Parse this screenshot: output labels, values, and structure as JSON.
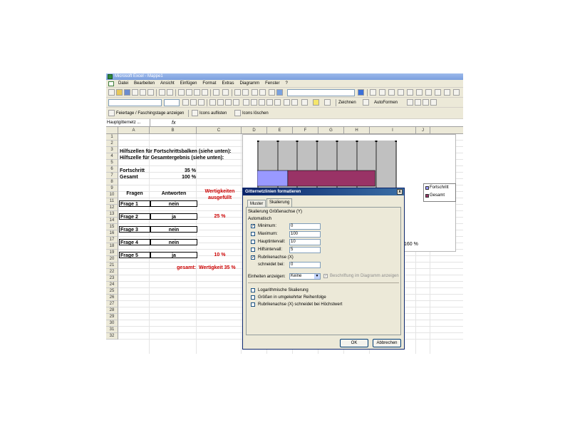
{
  "window": {
    "title": "Microsoft Excel - Mappe1"
  },
  "menubar": [
    "Datei",
    "Bearbeiten",
    "Ansicht",
    "Einfügen",
    "Format",
    "Extras",
    "Diagramm",
    "Fenster",
    "?"
  ],
  "toolbar3": {
    "draw_label": "Zeichnen",
    "autoshapes_label": "AutoFormen"
  },
  "toolbar4": {
    "holidays_button": "Feiertage / Faschingstage anzeigen",
    "list_icons_button": "Icons auflisten",
    "delete_icons_button": "Icons löschen"
  },
  "formula_bar": {
    "name_box": "Hauptgitternetz ...",
    "fx": "fx"
  },
  "columns": [
    "A",
    "B",
    "C",
    "D",
    "E",
    "F",
    "G",
    "H",
    "I",
    "J"
  ],
  "rows": [
    "1",
    "2",
    "3",
    "4",
    "5",
    "6",
    "7",
    "8",
    "9",
    "10",
    "11",
    "12",
    "13",
    "14",
    "15",
    "16",
    "17",
    "18",
    "19",
    "20",
    "21",
    "22",
    "23",
    "24",
    "25",
    "26",
    "27",
    "28",
    "29",
    "30",
    "31",
    "32"
  ],
  "sheet": {
    "a2": "Hilfszellen für Fortschrittsbalken (siehe unten):",
    "a3": "Hilfszelle für Gesamtergebnis (siehe unten):",
    "a5": "Fortschritt",
    "b5": "35 %",
    "a6": "Gesamt",
    "b6": "100 %",
    "a9": "Fragen",
    "b9": "Antworten",
    "c9": "Wertigkeiten ausgefüllt",
    "a10": "Frage 1",
    "b10": "nein",
    "a12": "Frage 2",
    "b12": "ja",
    "c12": "25 %",
    "a14": "Frage 3",
    "b14": "nein",
    "a16": "Frage 4",
    "b16": "nein",
    "a18": "Frage 5",
    "b18": "ja",
    "c18": "10 %",
    "b20": "gesamt:",
    "c20": "Wertigkeit 35 %"
  },
  "chart_data": {
    "type": "bar",
    "orientation": "horizontal-stacked",
    "series": [
      {
        "name": "Fortschritt",
        "values": [
          35
        ],
        "color": "#9999ff"
      },
      {
        "name": "Gesamt",
        "values": [
          100
        ],
        "color": "#993366"
      }
    ],
    "axis_visible_label": "160 %",
    "gridlines": 8,
    "legend": "right"
  },
  "dialog": {
    "title": "Gitternetzlinien formatieren",
    "close": "x",
    "tabs": [
      "Muster",
      "Skalierung"
    ],
    "active_tab": "Skalierung",
    "subtitle": "Skalierung Größenachse (Y)",
    "auto_label": "Automatisch",
    "fields": [
      {
        "label": "Minimum:",
        "checked": true,
        "value": "0"
      },
      {
        "label": "Maximum:",
        "checked": false,
        "value": "100"
      },
      {
        "label": "Hauptintervall:",
        "checked": false,
        "value": "10"
      },
      {
        "label": "Hilfsintervall:",
        "checked": false,
        "value": "5"
      },
      {
        "label": "Rubrikenachse (X)",
        "checked": true,
        "value": ""
      }
    ],
    "crosses_label": "schneidet bei:",
    "crosses_value": "0",
    "units_label": "Einheiten anzeigen:",
    "units_value": "Keine",
    "show_units_label": "Beschriftung im Diagramm anzeigen",
    "options": [
      "Logarithmische Skalierung",
      "Größen in umgekehrter Reihenfolge",
      "Rubrikenachse (X) schneidet bei Höchstwert"
    ],
    "ok": "OK",
    "cancel": "Abbrechen"
  }
}
